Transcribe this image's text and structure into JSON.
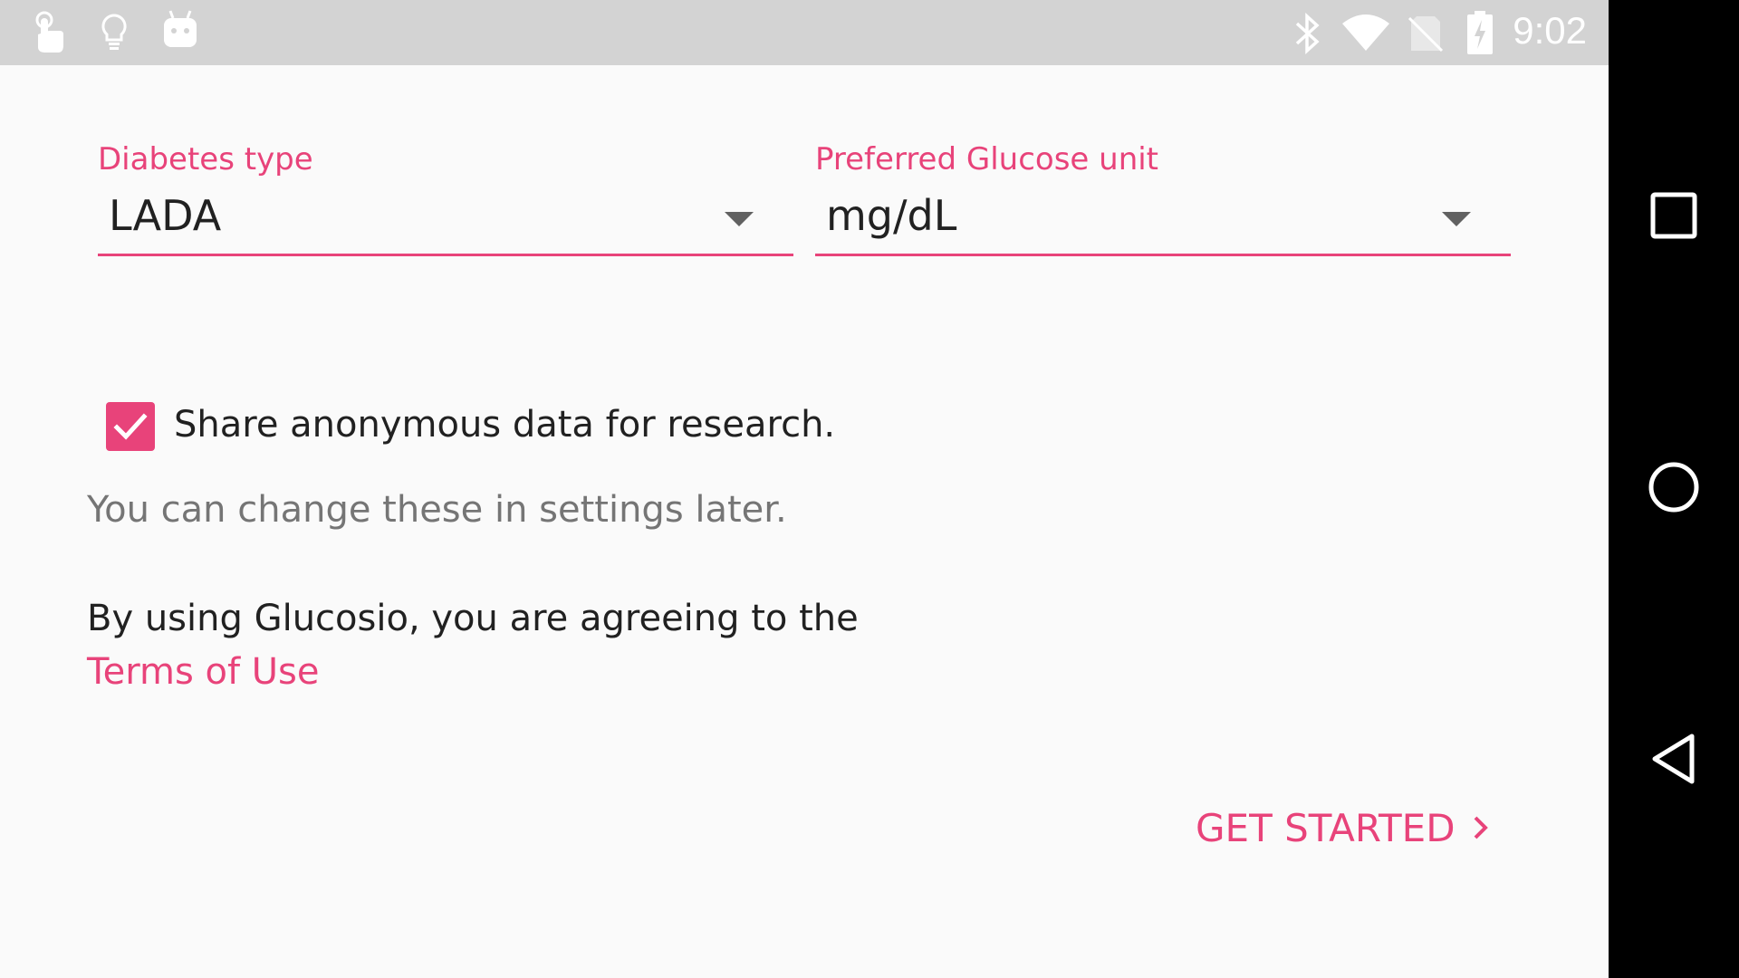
{
  "status_bar": {
    "time": "9:02",
    "left_icons": [
      "touch-icon",
      "lightbulb-icon",
      "android-icon"
    ],
    "right_icons": [
      "bluetooth-icon",
      "wifi-icon",
      "no-sim-icon",
      "battery-charging-icon"
    ]
  },
  "form": {
    "diabetes_type": {
      "label": "Diabetes type",
      "value": "LADA"
    },
    "glucose_unit": {
      "label": "Preferred Glucose unit",
      "value": "mg/dL"
    },
    "share_data": {
      "label": "Share anonymous data for research.",
      "checked": true
    },
    "hint": "You can change these in settings later.",
    "terms_text": "By using Glucosio, you are agreeing to the",
    "terms_link": "Terms of Use",
    "get_started": "GET STARTED"
  },
  "nav_bar": {
    "buttons": [
      "recents-icon",
      "home-icon",
      "back-icon"
    ]
  },
  "colors": {
    "accent": "#e8437a",
    "status_bar": "#d3d3d3",
    "background": "#fafafa",
    "nav_bar": "#000000"
  }
}
